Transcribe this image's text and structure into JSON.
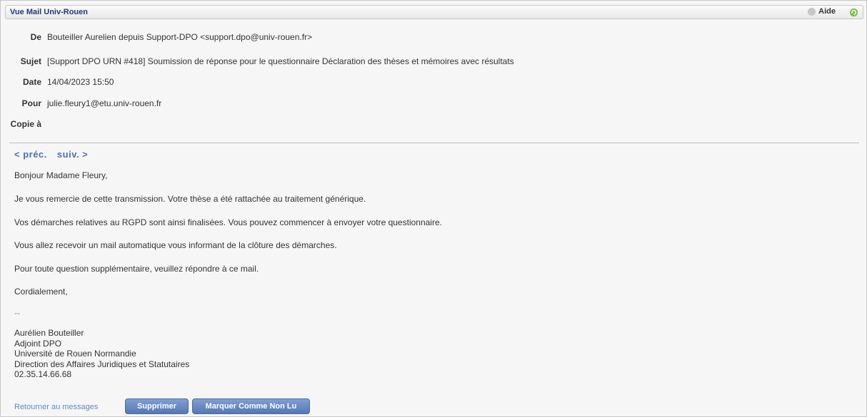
{
  "window": {
    "title": "Vue Mail Univ-Rouen",
    "help_label": "Aide"
  },
  "headers": {
    "from_label": "De",
    "from_value": "Bouteiller Aurelien depuis Support-DPO <support.dpo@univ-rouen.fr>",
    "subject_label": "Sujet",
    "subject_value": "[Support DPO URN #418] Soumission de réponse pour le questionnaire Déclaration des thèses et mémoires avec résultats",
    "date_label": "Date",
    "date_value": "14/04/2023 15:50",
    "to_label": "Pour",
    "to_value": "julie.fleury1@etu.univ-rouen.fr",
    "cc_label": "Copie à",
    "cc_value": ""
  },
  "nav": {
    "prev": "< préc.",
    "next": "suiv. >"
  },
  "body": {
    "greeting": "Bonjour Madame Fleury,",
    "p1": "Je vous remercie de cette transmission. Votre thèse a été rattachée au traitement générique.",
    "p2": "Vos démarches relatives au RGPD sont ainsi finalisées. Vous pouvez commencer à envoyer votre questionnaire.",
    "p3": "Vous allez recevoir un mail automatique vous informant de la clôture des démarches.",
    "p4": "Pour toute question supplémentaire, veuillez répondre à ce mail.",
    "closing": "Cordialement,",
    "separator": "--"
  },
  "signature": {
    "name": "Aurélien Bouteiller",
    "role": "Adjoint DPO",
    "org": "Université de Rouen Normandie",
    "dept": "Direction des Affaires Juridiques et Statutaires",
    "phone": "02.35.14.66.68"
  },
  "actions": {
    "back_label": "Retourner au messages",
    "delete_label": "Supprimer",
    "mark_unread_label": "Marquer Comme Non Lu"
  },
  "colors": {
    "title": "#1f3b7a",
    "link": "#5f8bc6",
    "button": "#5f80bd"
  },
  "icons": {
    "help": "help-icon",
    "refresh": "refresh-icon"
  }
}
